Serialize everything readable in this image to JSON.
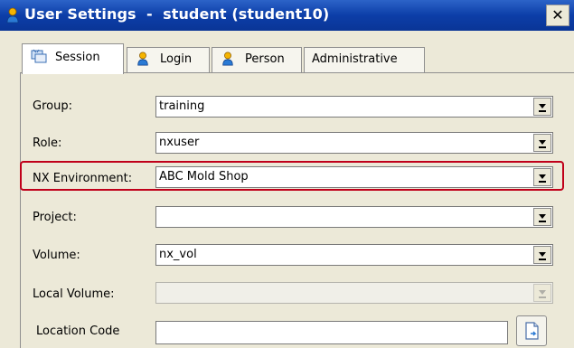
{
  "window": {
    "title": "User Settings  -  student (student10)",
    "close_glyph": "✕"
  },
  "tabs": [
    {
      "label": "Session",
      "icon": "session-icon",
      "selected": true
    },
    {
      "label": "Login",
      "icon": "user-icon",
      "selected": false
    },
    {
      "label": "Person",
      "icon": "user-icon",
      "selected": false
    },
    {
      "label": "Administrative",
      "icon": "",
      "selected": false
    }
  ],
  "fields": {
    "group": {
      "label": "Group:",
      "value": "training"
    },
    "role": {
      "label": "Role:",
      "value": "nxuser"
    },
    "nx_environment": {
      "label": "NX Environment:",
      "value": "ABC Mold Shop"
    },
    "project": {
      "label": "Project:",
      "value": ""
    },
    "volume": {
      "label": "Volume:",
      "value": "nx_vol"
    },
    "local_volume": {
      "label": "Local Volume:",
      "value": "",
      "disabled": true
    },
    "location_code": {
      "label": "Location Code",
      "value": ""
    }
  },
  "colors": {
    "titlebar": "#0a3596",
    "highlight": "#c0001a",
    "window_bg": "#ece9d8"
  }
}
